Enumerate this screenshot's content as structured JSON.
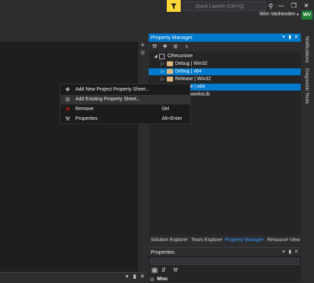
{
  "titlebar": {
    "quick_launch_placeholder": "Quick Launch (Ctrl+Q)",
    "user_name": "Wim Vanhenden",
    "user_initials": "WV"
  },
  "property_manager": {
    "title": "Property Manager",
    "tree": [
      {
        "label": "CRecursive",
        "expanded": true
      },
      {
        "label": "Debug | Win32",
        "selected": false
      },
      {
        "label": "Debug | x64",
        "selected": true
      },
      {
        "label": "Release | Win32",
        "selected": false
      },
      {
        "label": "Release | x64",
        "selected": true
      },
      {
        "label": "worksLib",
        "selected": false
      }
    ]
  },
  "context_menu": {
    "items": [
      {
        "label": "Add New Project Property Sheet...",
        "shortcut": "",
        "icon": "add-new-sheet-icon"
      },
      {
        "label": "Add Existing Property Sheet...",
        "shortcut": "",
        "icon": "add-existing-sheet-icon",
        "hover": true
      },
      {
        "label": "Remove",
        "shortcut": "Del",
        "icon": "remove-icon"
      },
      {
        "label": "Properties",
        "shortcut": "Alt+Enter",
        "icon": "wrench-icon"
      }
    ]
  },
  "panel_tabs": [
    "Solution Explorer",
    "Team Explorer",
    "Property Manager",
    "Resource View"
  ],
  "active_tab": "Property Manager",
  "properties_panel": {
    "title": "Properties",
    "category": "Misc"
  },
  "side_tabs": [
    "Notifications",
    "Diagnostic Tools"
  ],
  "colors": {
    "accent": "#007acc",
    "feedback": "#fdd835",
    "avatar": "#1e7e34"
  }
}
